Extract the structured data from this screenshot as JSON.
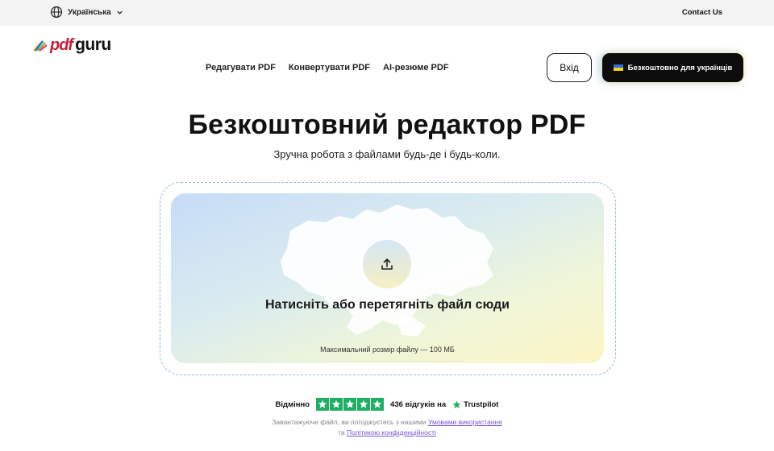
{
  "topbar": {
    "language_label": "Українська",
    "contact_label": "Contact Us"
  },
  "header": {
    "logo_pdf": "pdf",
    "logo_guru": "guru",
    "nav": [
      {
        "label": "Редагувати PDF"
      },
      {
        "label": "Конвертувати PDF"
      },
      {
        "label": "AI-резюме PDF"
      }
    ],
    "login_label": "Вхід",
    "cta_label": "Безкоштовно для українців"
  },
  "hero": {
    "title": "Безкоштовний редактор PDF",
    "subtitle": "Зручна робота з файлами будь-де і будь-коли."
  },
  "dropzone": {
    "main_text": "Натисніть або перетягніть файл сюди",
    "note": "Максимальний розмір файлу — 100 МБ"
  },
  "rating": {
    "word": "Відмінно",
    "stars": 5,
    "count_text": "436 відгуків на",
    "platform": "Trustpilot"
  },
  "consent": {
    "prefix": "Завантажуючи файл, ви погоджуєтесь з нашими",
    "terms_link": "Умовами використання",
    "middle": "та",
    "privacy_link": "Політикою конфіденційності"
  },
  "colors": {
    "brand_red": "#c21f3a",
    "cta_bg": "#0d0d0d",
    "trustpilot_green": "#1fae62",
    "link_purple": "#7a55d8"
  },
  "icons": [
    "globe-icon",
    "chevron-down-icon",
    "ukraine-flag-icon",
    "upload-icon",
    "star-icon",
    "trustpilot-star-icon",
    "ukraine-map-icon"
  ]
}
